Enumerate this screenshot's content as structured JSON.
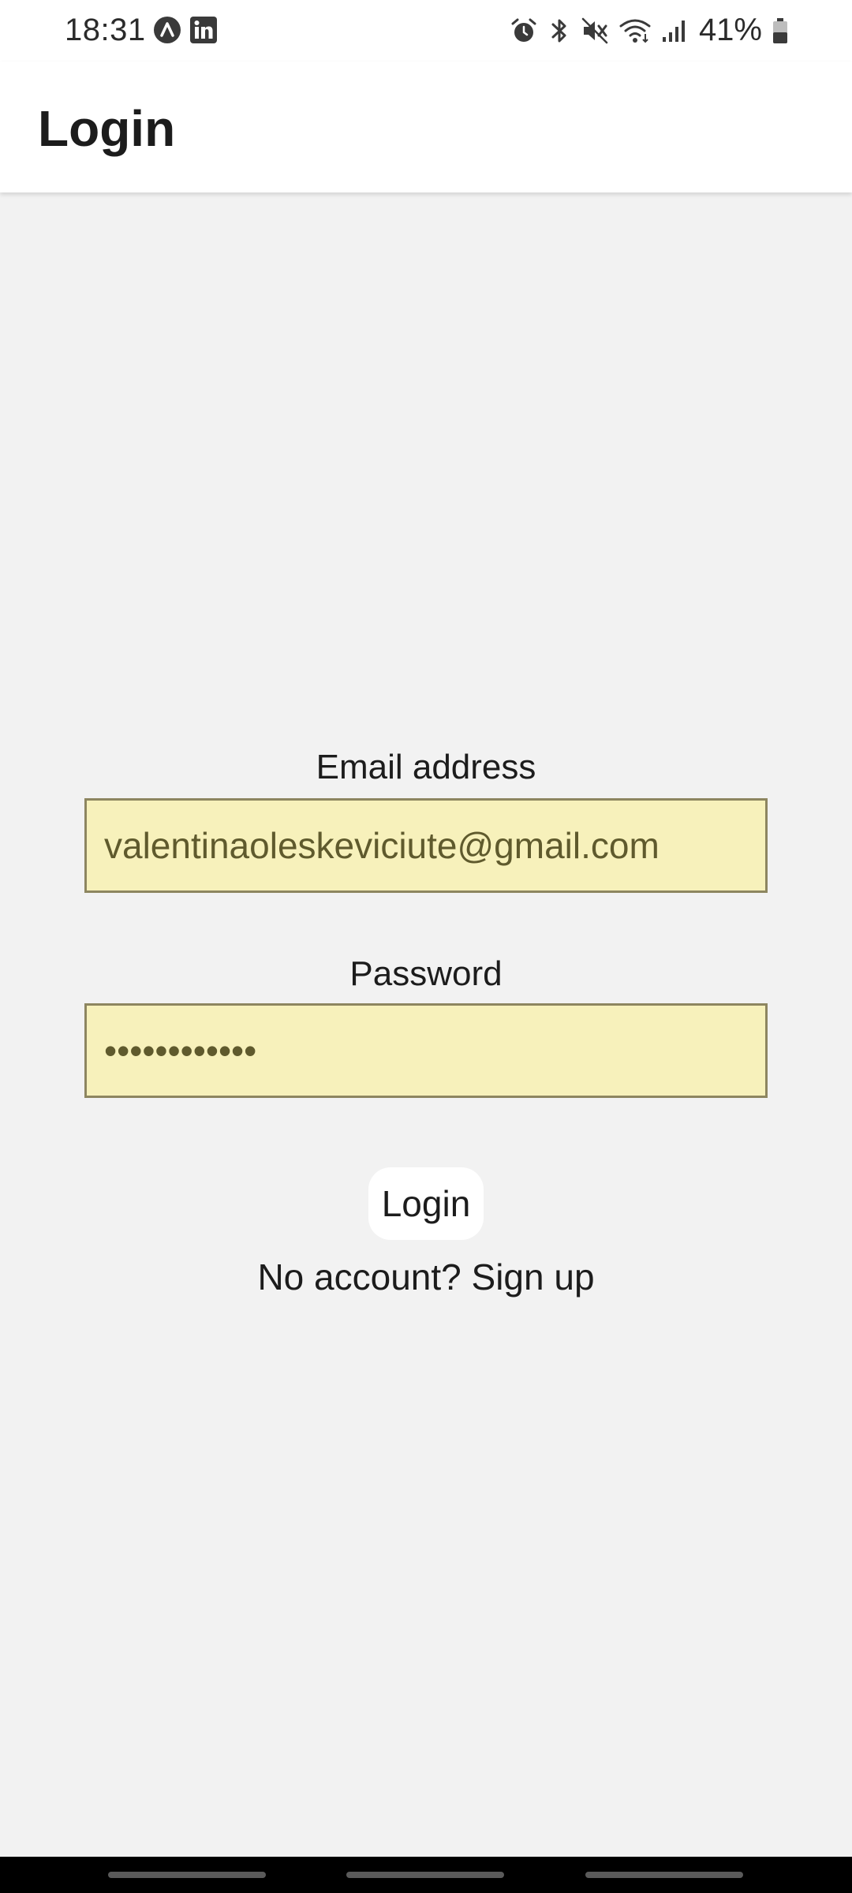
{
  "status_bar": {
    "time": "18:31",
    "battery": "41%",
    "icons": [
      "notification-a-icon",
      "linkedin-icon",
      "alarm-icon",
      "bluetooth-icon",
      "mute-icon",
      "wifi-icon",
      "signal-icon",
      "battery-icon"
    ]
  },
  "app_bar": {
    "title": "Login"
  },
  "form": {
    "email_label": "Email address",
    "email_value": "valentinaoleskeviciute@gmail.com",
    "password_label": "Password",
    "password_value": "••••••••••••",
    "login_label": "Login",
    "signup_text": "No account? Sign up"
  },
  "colors": {
    "background": "#f2f2f2",
    "input_fill": "#f7f1bb",
    "input_border": "#8d8660",
    "input_text": "#5f5a2d"
  }
}
